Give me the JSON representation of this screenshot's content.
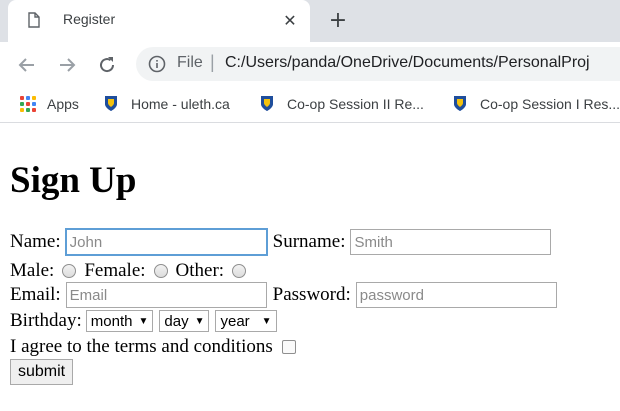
{
  "browser": {
    "tab_title": "Register",
    "close_glyph": "✕",
    "newtab_glyph": "+",
    "omnibox_scheme": "File",
    "omnibox_separator": "|",
    "omnibox_url": "C:/Users/panda/OneDrive/Documents/PersonalProj",
    "bookmarks": [
      {
        "label": "Apps",
        "icon": "apps-grid-icon"
      },
      {
        "label": "Home - uleth.ca",
        "icon": "shield-icon"
      },
      {
        "label": "Co-op Session II Re...",
        "icon": "shield-icon"
      },
      {
        "label": "Co-op Session I Res...",
        "icon": "shield-icon"
      }
    ]
  },
  "form": {
    "heading": "Sign Up",
    "name_label": "Name:",
    "name_placeholder": "John",
    "surname_label": "Surname:",
    "surname_placeholder": "Smith",
    "male_label": "Male:",
    "female_label": "Female:",
    "other_label": "Other:",
    "email_label": "Email:",
    "email_placeholder": "Email",
    "password_label": "Password:",
    "password_placeholder": "password",
    "birthday_label": "Birthday:",
    "month_value": "month",
    "day_value": "day",
    "year_value": "year",
    "select_arrow": "▼",
    "terms_label": "I agree to the terms and conditions",
    "submit_label": "submit"
  },
  "colors": {
    "tabstrip_bg": "#dee1e6",
    "omnibox_bg": "#f1f3f4",
    "focus_border": "#5e9ed6",
    "shield_blue": "#1f4e9c",
    "shield_gold": "#f4c20d"
  }
}
